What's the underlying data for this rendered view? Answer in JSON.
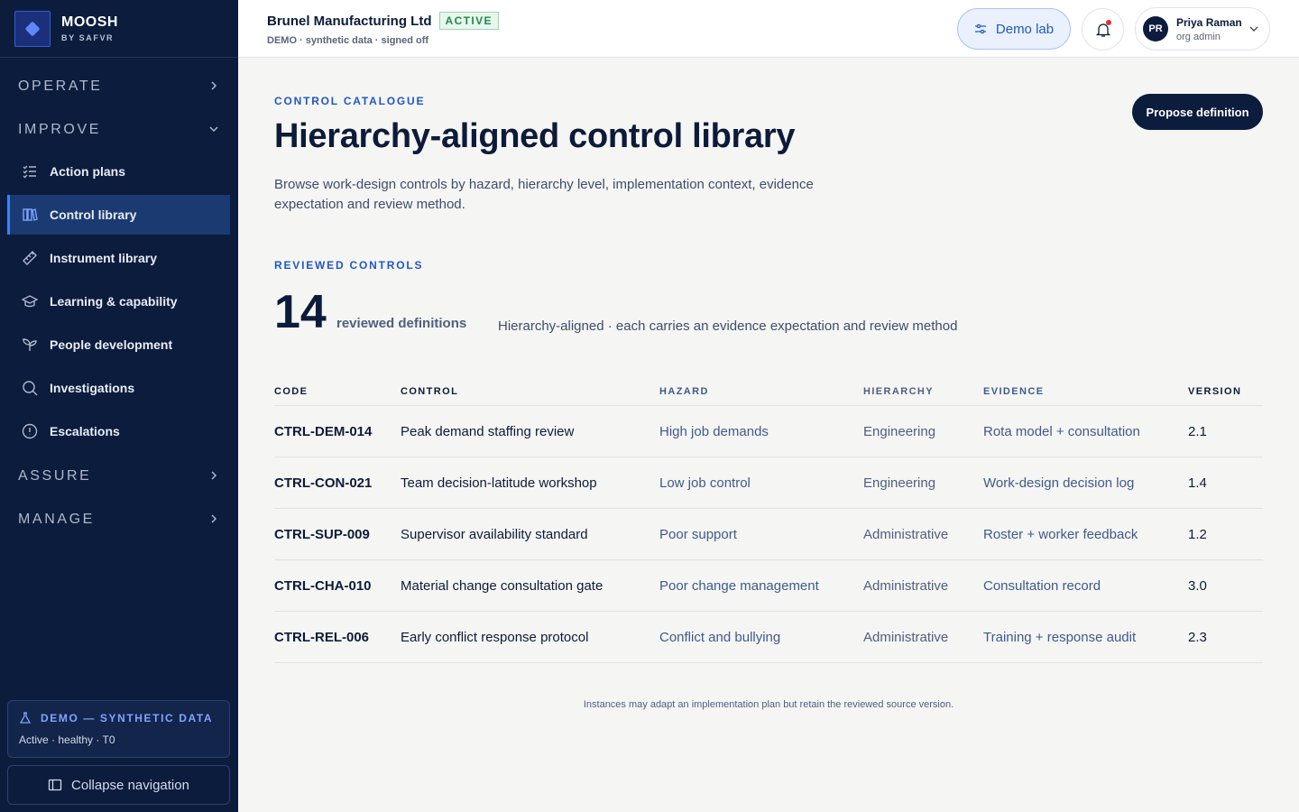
{
  "brand": {
    "name": "MOOSH",
    "sub": "BY SAFVR"
  },
  "sidebar": {
    "sections": {
      "operate": "OPERATE",
      "improve": "IMPROVE",
      "assure": "ASSURE",
      "manage": "MANAGE"
    },
    "items": [
      {
        "label": "Action plans",
        "icon": "checklist-icon"
      },
      {
        "label": "Control library",
        "icon": "library-icon",
        "active": true
      },
      {
        "label": "Instrument library",
        "icon": "ruler-icon"
      },
      {
        "label": "Learning & capability",
        "icon": "graduation-cap-icon"
      },
      {
        "label": "People development",
        "icon": "sprout-icon"
      },
      {
        "label": "Investigations",
        "icon": "search-icon"
      },
      {
        "label": "Escalations",
        "icon": "alert-circle-icon"
      }
    ],
    "demo": {
      "title": "DEMO — SYNTHETIC DATA",
      "status": "Active · healthy · T0"
    },
    "collapse_label": "Collapse navigation"
  },
  "header": {
    "org_name": "Brunel Manufacturing Ltd",
    "org_badge": "ACTIVE",
    "org_sub": "DEMO · synthetic data · signed off",
    "demo_lab_label": "Demo lab",
    "user": {
      "initials": "PR",
      "name": "Priya Raman",
      "role": "org admin"
    }
  },
  "main": {
    "eyebrow": "CONTROL CATALOGUE",
    "title": "Hierarchy-aligned control library",
    "description": "Browse work-design controls by hazard, hierarchy level, implementation context, evidence expectation and review method.",
    "propose_label": "Propose definition",
    "reviewed": {
      "eyebrow": "REVIEWED CONTROLS",
      "count": "14",
      "count_label": "reviewed definitions",
      "note": "Hierarchy-aligned · each carries an evidence expectation and review method"
    },
    "table": {
      "headers": {
        "code": "CODE",
        "control": "CONTROL",
        "hazard": "HAZARD",
        "hierarchy": "HIERARCHY",
        "evidence": "EVIDENCE",
        "version": "VERSION"
      },
      "rows": [
        {
          "code": "CTRL-DEM-014",
          "control": "Peak demand staffing review",
          "hazard": "High job demands",
          "hierarchy": "Engineering",
          "evidence": "Rota model + consultation",
          "version": "2.1"
        },
        {
          "code": "CTRL-CON-021",
          "control": "Team decision-latitude workshop",
          "hazard": "Low job control",
          "hierarchy": "Engineering",
          "evidence": "Work-design decision log",
          "version": "1.4"
        },
        {
          "code": "CTRL-SUP-009",
          "control": "Supervisor availability standard",
          "hazard": "Poor support",
          "hierarchy": "Administrative",
          "evidence": "Roster + worker feedback",
          "version": "1.2"
        },
        {
          "code": "CTRL-CHA-010",
          "control": "Material change consultation gate",
          "hazard": "Poor change management",
          "hierarchy": "Administrative",
          "evidence": "Consultation record",
          "version": "3.0"
        },
        {
          "code": "CTRL-REL-006",
          "control": "Early conflict response protocol",
          "hazard": "Conflict and bullying",
          "hierarchy": "Administrative",
          "evidence": "Training + response audit",
          "version": "2.3"
        }
      ]
    },
    "footnote": "Instances may adapt an implementation plan but retain the reviewed source version."
  },
  "colors": {
    "sidebar_bg": "#0c1c3d",
    "accent": "#1f58c4",
    "active_badge": "#1f8a4c",
    "notification": "#e0302d"
  }
}
